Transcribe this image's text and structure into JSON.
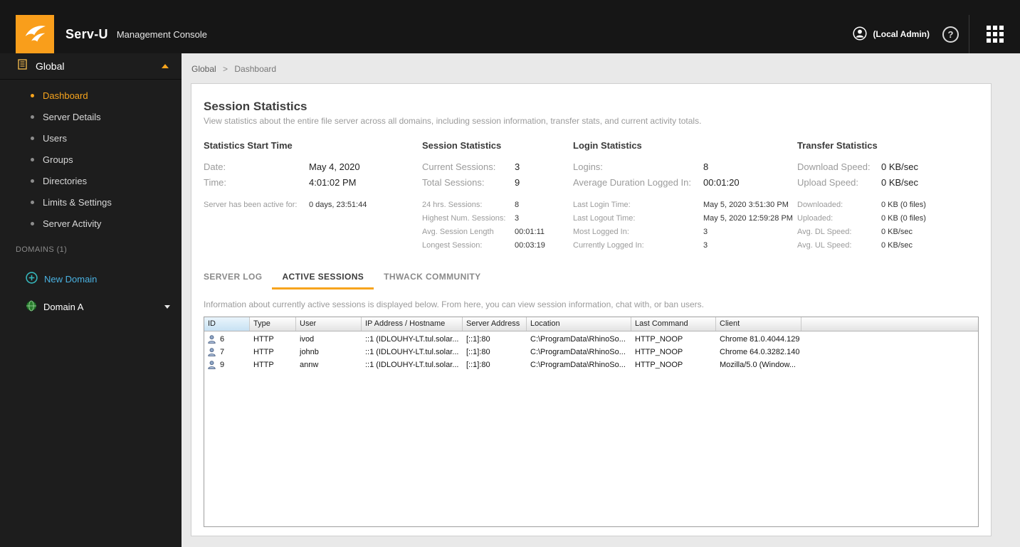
{
  "colors": {
    "accent_orange": "#f7a41d",
    "logo_orange": "#f99e1b",
    "topbar_bg": "#161616",
    "sidebar_bg": "#1d1d1d",
    "link_blue": "#4ab2e2",
    "sorted_header_bg": "#c7e1f3"
  },
  "topbar": {
    "brand": "Serv-U",
    "brand_suffix": "Management Console",
    "account_label": "(Local Admin)",
    "help_glyph": "?"
  },
  "sidebar": {
    "section_label": "Global",
    "items": [
      {
        "label": "Dashboard",
        "active": true
      },
      {
        "label": "Server Details",
        "active": false
      },
      {
        "label": "Users",
        "active": false
      },
      {
        "label": "Groups",
        "active": false
      },
      {
        "label": "Directories",
        "active": false
      },
      {
        "label": "Limits & Settings",
        "active": false
      },
      {
        "label": "Server Activity",
        "active": false
      }
    ],
    "domains_label": "DOMAINS (1)",
    "new_domain_label": "New Domain",
    "domain_label": "Domain A"
  },
  "breadcrumb": {
    "root": "Global",
    "sep": ">",
    "current": "Dashboard"
  },
  "panel": {
    "title": "Session Statistics",
    "subtitle": "View statistics about the entire file server across all domains, including session information, transfer stats, and current activity totals."
  },
  "stats_groups": [
    {
      "title": "Statistics Start Time",
      "primary": [
        [
          "Date:",
          "May 4, 2020"
        ],
        [
          "Time:",
          "4:01:02 PM"
        ]
      ],
      "secondary": [
        [
          "Server has been active for:",
          "0 days, 23:51:44"
        ]
      ]
    },
    {
      "title": "Session Statistics",
      "primary": [
        [
          "Current Sessions:",
          "3"
        ],
        [
          "Total Sessions:",
          "9"
        ]
      ],
      "secondary": [
        [
          "24 hrs. Sessions:",
          "8"
        ],
        [
          "Highest Num. Sessions:",
          "3"
        ],
        [
          "Avg. Session Length",
          "00:01:11"
        ],
        [
          "Longest Session:",
          "00:03:19"
        ]
      ]
    },
    {
      "title": "Login Statistics",
      "primary": [
        [
          "Logins:",
          "8"
        ],
        [
          "Average Duration Logged In:",
          "00:01:20"
        ]
      ],
      "secondary": [
        [
          "Last Login Time:",
          "May 5, 2020 3:51:30 PM"
        ],
        [
          "Last Logout Time:",
          "May 5, 2020 12:59:28 PM"
        ],
        [
          "Most Logged In:",
          "3"
        ],
        [
          "Currently Logged In:",
          "3"
        ]
      ]
    },
    {
      "title": "Transfer Statistics",
      "primary": [
        [
          "Download Speed:",
          "0 KB/sec"
        ],
        [
          "Upload Speed:",
          "0 KB/sec"
        ]
      ],
      "secondary": [
        [
          "Downloaded:",
          "0 KB (0 files)"
        ],
        [
          "Uploaded:",
          "0 KB (0 files)"
        ],
        [
          "Avg. DL Speed:",
          "0 KB/sec"
        ],
        [
          "Avg. UL Speed:",
          "0 KB/sec"
        ]
      ]
    }
  ],
  "tabs": [
    {
      "label": "SERVER LOG",
      "active": false
    },
    {
      "label": "ACTIVE SESSIONS",
      "active": true
    },
    {
      "label": "THWACK COMMUNITY",
      "active": false
    }
  ],
  "sessions": {
    "description": "Information about currently active sessions is displayed below. From here, you can view session information, chat with, or ban users.",
    "sorted_column": 0,
    "columns": [
      "ID",
      "Type",
      "User",
      "IP Address / Hostname",
      "Server Address",
      "Location",
      "Last Command",
      "Client"
    ],
    "rows": [
      [
        "6",
        "HTTP",
        "ivod",
        "::1 (IDLOUHY-LT.tul.solar...",
        "[::1]:80",
        "C:\\ProgramData\\RhinoSo...",
        "HTTP_NOOP",
        "Chrome 81.0.4044.129"
      ],
      [
        "7",
        "HTTP",
        "johnb",
        "::1 (IDLOUHY-LT.tul.solar...",
        "[::1]:80",
        "C:\\ProgramData\\RhinoSo...",
        "HTTP_NOOP",
        "Chrome 64.0.3282.140"
      ],
      [
        "9",
        "HTTP",
        "annw",
        "::1 (IDLOUHY-LT.tul.solar...",
        "[::1]:80",
        "C:\\ProgramData\\RhinoSo...",
        "HTTP_NOOP",
        "Mozilla/5.0 (Window..."
      ]
    ]
  }
}
